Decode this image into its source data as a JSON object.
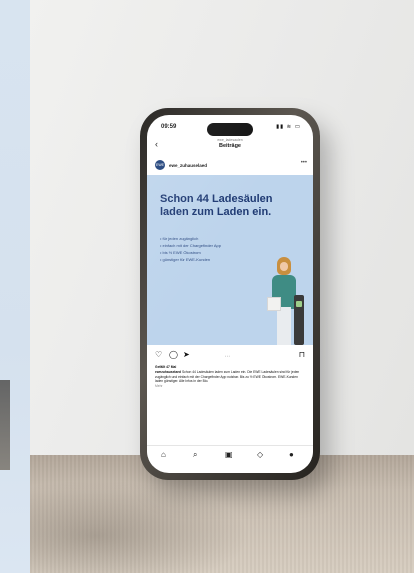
{
  "status_bar": {
    "time": "09:59",
    "icons": "▮▮ ≋ ▭"
  },
  "nav": {
    "back_icon": "chevron-left-icon",
    "username": "ewe_ladesaulen",
    "title": "Beiträge"
  },
  "post": {
    "avatar_text": "EWE",
    "username": "ewe_zuhauselaed",
    "more_icon": "•••",
    "headline": "Schon 44 Ladesäulen laden zum Laden ein.",
    "bullets": [
      "• für jeden zugänglich",
      "• einfach mit der Chargefinder App",
      "• bis ½ EWE Ökostrom",
      "• günstiger für EWE-Kunden"
    ],
    "likes": "Gefällt 47 Mal",
    "caption_user": "ewezuhauselaed",
    "caption_text": "Schon 44 Ladesäulen laden zum Laden ein. Die EWE Ladesäulen sind für jeden zugänglich und einfach mit der Chargefinder App nutzbar. Bis zu ½ EWE Ökostrom. EWE-Kunden laden günstiger. Alle Infos in der Bio.",
    "more_link": "Mehr"
  },
  "tabbar": {
    "home": "⌂",
    "search": "⌕",
    "reels": "▣",
    "shop": "◇",
    "profile": "●"
  },
  "icons": {
    "like": "♡",
    "comment": "◯",
    "share": "➤",
    "save": "⊓"
  },
  "colors": {
    "post_background": "#bdd4ec",
    "headline": "#1f3a73",
    "brand": "#1c3f79"
  }
}
